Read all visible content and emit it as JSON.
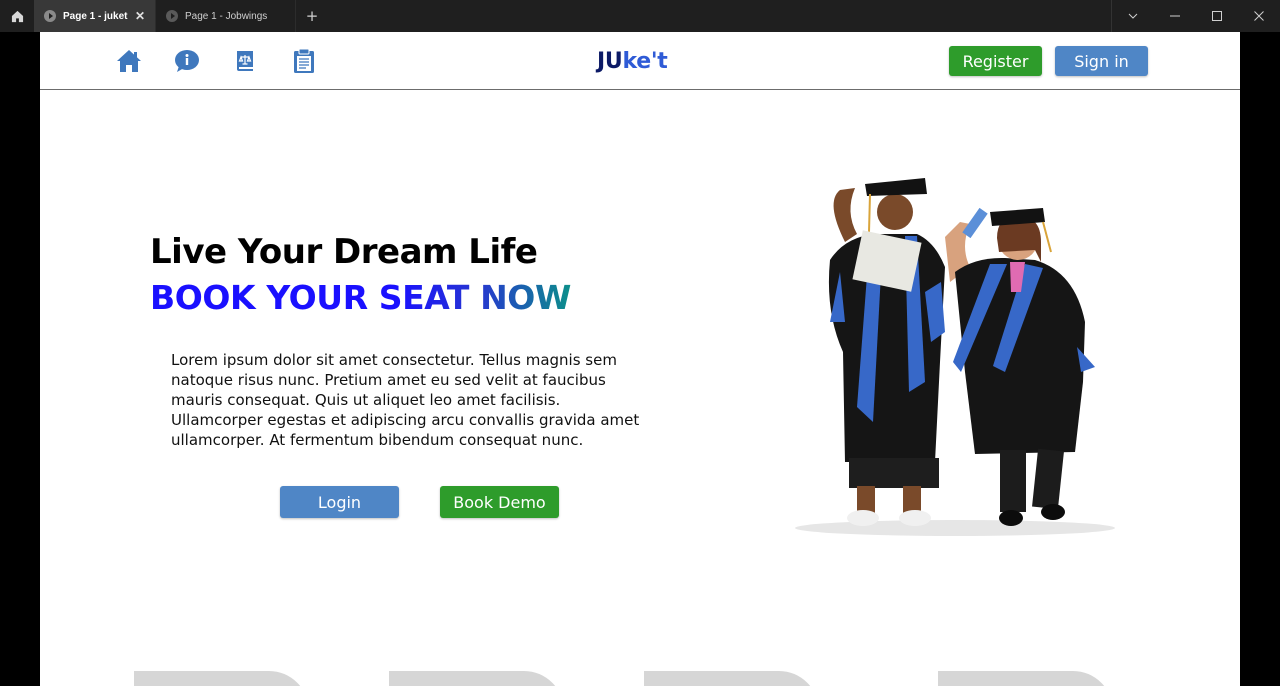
{
  "browser": {
    "tabs": [
      {
        "label": "Page 1 - juket",
        "active": true
      },
      {
        "label": "Page 1 - Jobwings",
        "active": false
      }
    ],
    "icons": {
      "home": "home-icon",
      "new_tab": "plus-icon",
      "dropdown": "chevron-down-icon",
      "minimize": "minimize-icon",
      "maximize": "maximize-icon",
      "close": "close-icon"
    }
  },
  "navbar": {
    "icons": [
      "home-icon",
      "info-chat-icon",
      "book-icon",
      "clipboard-icon"
    ],
    "logo": {
      "part1": "JU",
      "part2": "ke't"
    },
    "register_label": "Register",
    "signin_label": "Sign in"
  },
  "hero": {
    "title": "Live Your Dream Life",
    "cta": "BOOK YOUR SEAT NOW",
    "body": "Lorem ipsum dolor sit amet consectetur. Tellus magnis sem natoque risus nunc. Pretium amet eu sed velit at faucibus mauris consequat. Quis ut aliquet leo amet facilisis. Ullamcorper egestas et adipiscing arcu convallis gravida amet ullamcorper. At fermentum bibendum consequat nunc.",
    "login_label": "Login",
    "demo_label": "Book Demo"
  },
  "colors": {
    "accent_blue": "#4f86c6",
    "accent_green": "#2e9c2b",
    "nav_icon_blue": "#3f78bd",
    "cta_blue": "#1a10ff",
    "cta_teal": "#0c8f8a",
    "logo_dark": "#0c1a66",
    "logo_light": "#2f5bd6"
  }
}
